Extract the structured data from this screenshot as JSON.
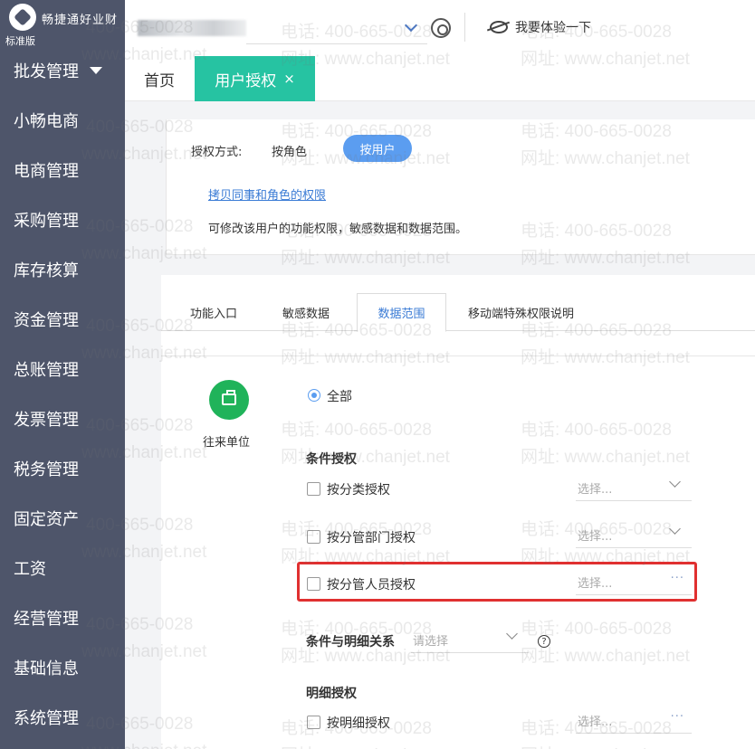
{
  "brand": {
    "name": "畅捷通好业财",
    "edition": "标准版"
  },
  "sidebar": {
    "items": [
      {
        "label": "批发管理"
      },
      {
        "label": "小畅电商"
      },
      {
        "label": "电商管理"
      },
      {
        "label": "采购管理"
      },
      {
        "label": "库存核算"
      },
      {
        "label": "资金管理"
      },
      {
        "label": "总账管理"
      },
      {
        "label": "发票管理"
      },
      {
        "label": "税务管理"
      },
      {
        "label": "固定资产"
      },
      {
        "label": "工资"
      },
      {
        "label": "经营管理"
      },
      {
        "label": "基础信息"
      },
      {
        "label": "系统管理"
      }
    ]
  },
  "header": {
    "trial_label": "我要体验一下"
  },
  "tabs": {
    "home": "首页",
    "active": "用户授权",
    "close": "×"
  },
  "auth_mode": {
    "label": "授权方式:",
    "by_role": "按角色",
    "by_user": "按用户",
    "copy_link": "拷贝同事和角色的权限",
    "description": "可修改该用户的功能权限，敏感数据和数据范围。"
  },
  "subtabs": {
    "functions": "功能入口",
    "sensitive": "敏感数据",
    "data_range": "数据范围",
    "mobile": "移动端特殊权限说明"
  },
  "data_range": {
    "object_label": "往来单位",
    "all_label": "全部",
    "condition_title": "条件授权",
    "by_category": "按分类授权",
    "by_department": "按分管部门授权",
    "by_person": "按分管人员授权",
    "select_placeholder": "选择...",
    "relation_label": "条件与明细关系",
    "relation_placeholder": "请选择",
    "relation_help": "?",
    "detail_title": "明细授权",
    "by_detail": "按明细授权"
  },
  "watermark": {
    "phone": "电话: 400-665-0028",
    "site": "网址: www.chanjet.net",
    "number": "400-665-0028",
    "url": "www.chanjet.net"
  }
}
